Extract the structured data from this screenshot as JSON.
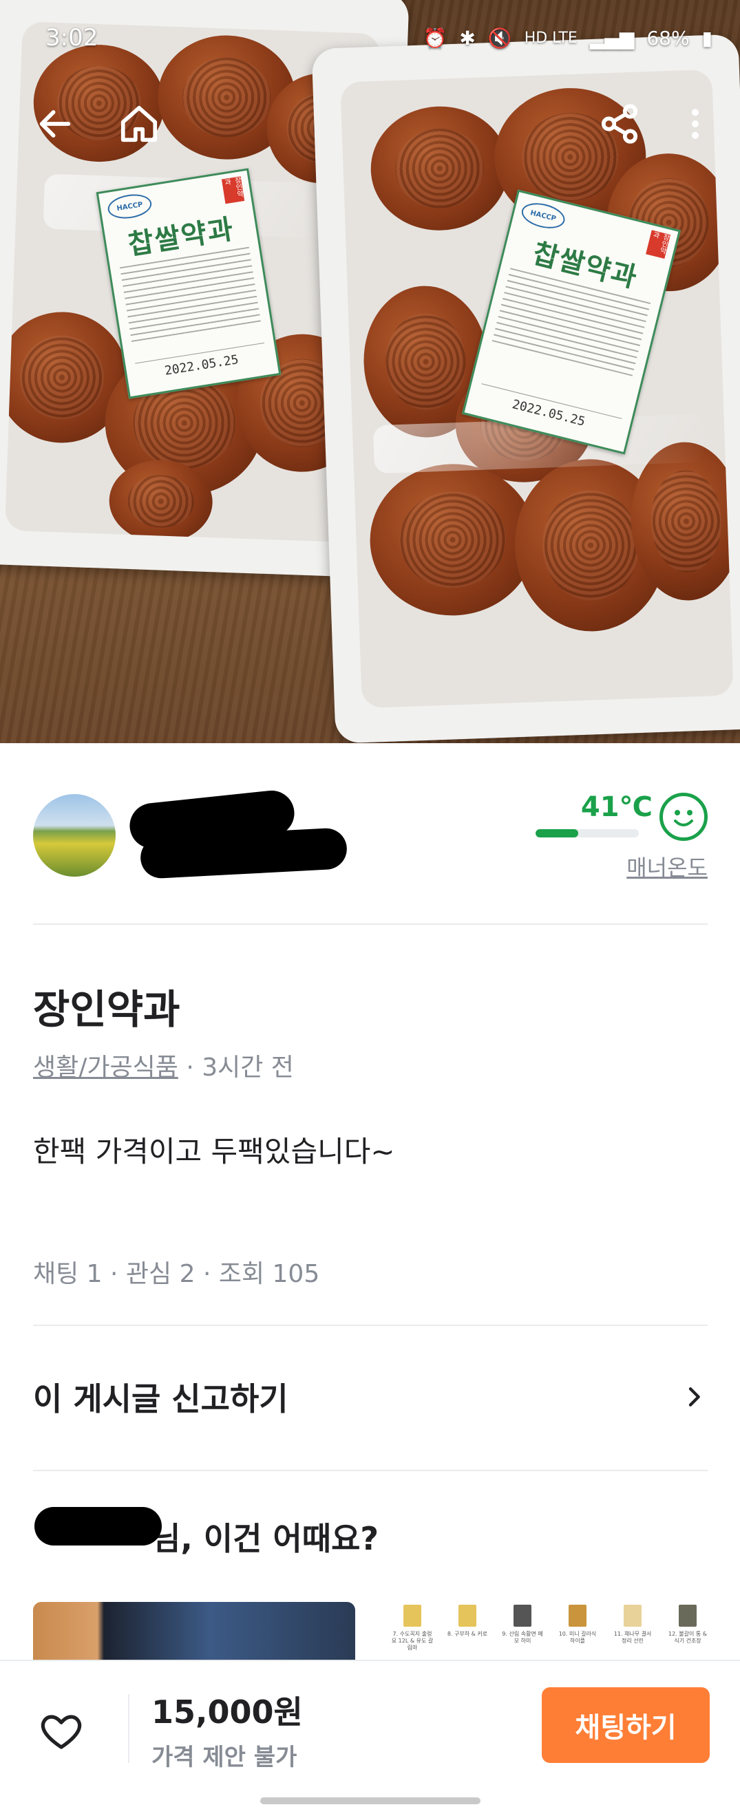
{
  "status_bar": {
    "time": "3:02",
    "network": "HD LTE",
    "battery": "68%"
  },
  "photo": {
    "package_label_title": "찹쌀약과",
    "package_label_badge": "HACCP",
    "package_label_stamp": "장인약과",
    "package_label_date": "2022.05.25"
  },
  "seller": {
    "manner_temperature": "41℃",
    "manner_level": 0.41,
    "manner_label": "매너온도"
  },
  "article": {
    "title": "장인약과",
    "category": "생활/가공식품",
    "time_ago": "· 3시간 전",
    "body": "한팩 가격이고 두팩있습니다~",
    "stats": "채팅 1 · 관심 2 · 조회 105"
  },
  "report": {
    "label": "이 게시글 신고하기"
  },
  "recommend": {
    "heading_suffix": "님, 이건 어때요?",
    "doc_captions": [
      "7. 수도꼭지 출렁 요 12L & 유도 갈림마",
      "8. 구부하 & 커로",
      "9. 산림 속활면 메모 하미",
      "10. 미니 갈라식 하이플",
      "11. 채나무 결서 정리 선린",
      "12. 불갈이 통 & 식기 건조장"
    ]
  },
  "bottom": {
    "price": "15,000원",
    "negotiation": "가격 제안 불가",
    "chat_button": "채팅하기"
  },
  "colors": {
    "accent": "#ff7e36",
    "manner_green": "#1aa14a",
    "text_secondary": "#868b94"
  },
  "icons": [
    "back-arrow-icon",
    "home-icon",
    "share-icon",
    "more-vertical-icon",
    "smile-face-icon",
    "chevron-right-icon",
    "heart-icon"
  ]
}
